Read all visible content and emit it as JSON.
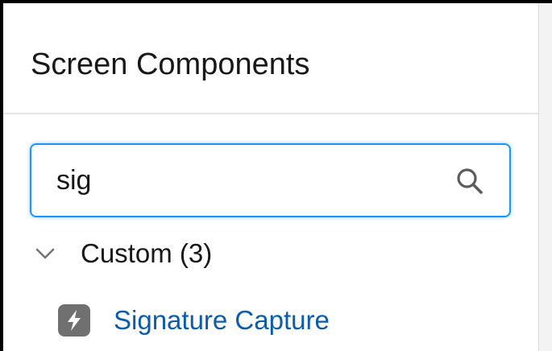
{
  "panel": {
    "title": "Screen Components"
  },
  "search": {
    "value": "sig",
    "icon": "search-icon"
  },
  "section": {
    "label": "Custom (3)",
    "expanded": true,
    "icon": "chevron-down-icon"
  },
  "components": [
    {
      "label": "Signature Capture",
      "icon": "lightning-bolt-icon"
    }
  ],
  "colors": {
    "focus_border": "#1b96ff",
    "link": "#0b5cab",
    "text": "#181818",
    "icon_bg": "#707070",
    "chevron": "#747474"
  }
}
